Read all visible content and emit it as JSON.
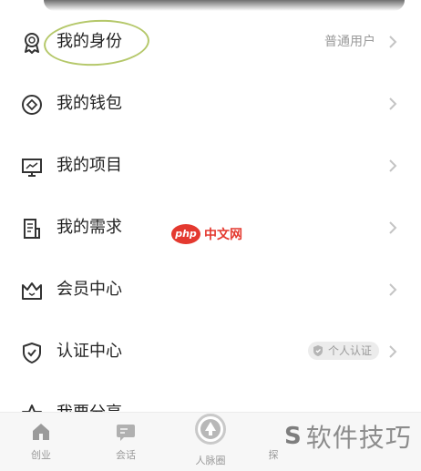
{
  "menu": {
    "items": [
      {
        "label": "我的身份",
        "value": "普通用户",
        "icon": "identity-medal-icon"
      },
      {
        "label": "我的钱包",
        "value": "",
        "icon": "wallet-icon"
      },
      {
        "label": "我的项目",
        "value": "",
        "icon": "project-monitor-icon"
      },
      {
        "label": "我的需求",
        "value": "",
        "icon": "demand-document-icon"
      },
      {
        "label": "会员中心",
        "value": "",
        "icon": "crown-icon"
      },
      {
        "label": "认证中心",
        "value": "",
        "icon": "shield-icon",
        "badge": "个人认证"
      },
      {
        "label": "我要分享",
        "value": "",
        "icon": "share-star-icon"
      }
    ]
  },
  "tabbar": {
    "tabs": [
      {
        "label": "创业",
        "icon": "home-icon"
      },
      {
        "label": "会话",
        "icon": "chat-icon"
      },
      {
        "label": "人脉圈",
        "icon": "circle-logo-icon"
      },
      {
        "label": "探",
        "icon": "explore-icon"
      }
    ]
  },
  "watermarks": {
    "php": {
      "badge": "php",
      "text": "中文网"
    },
    "bottom": {
      "logo": "S",
      "text": "软件技巧"
    }
  },
  "colors": {
    "highlight": "#b5c86a",
    "php_red": "#e4392f",
    "muted_text": "#9a9a9a"
  }
}
